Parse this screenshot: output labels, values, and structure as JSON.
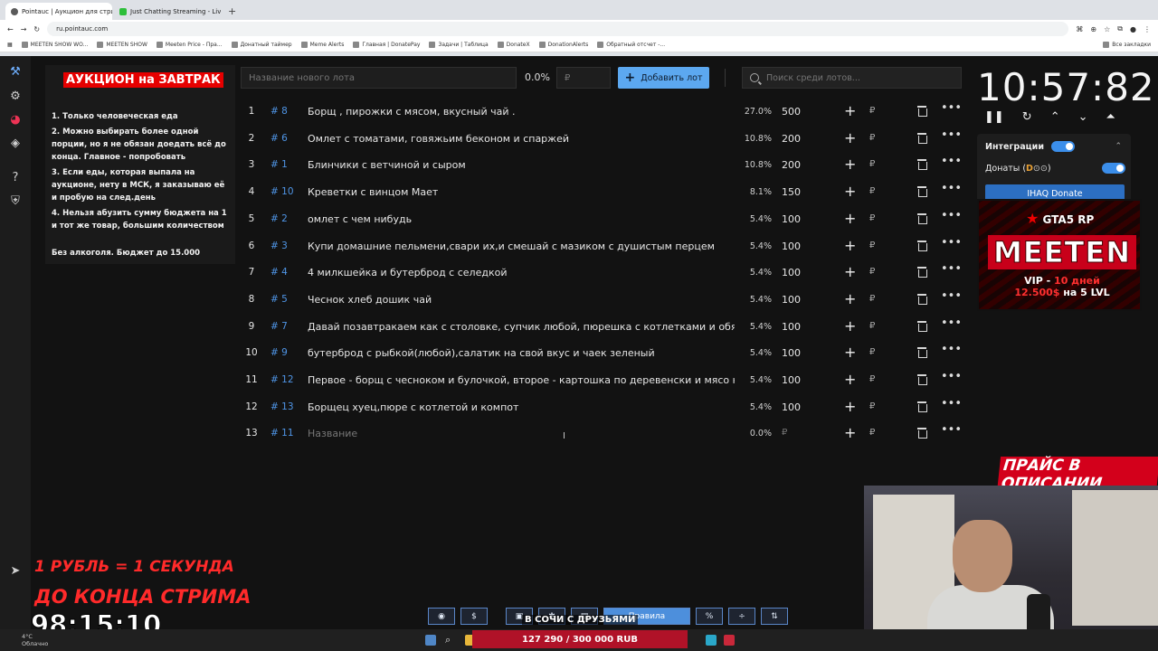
{
  "browser": {
    "tabs": [
      {
        "title": "Pointauc | Аукцион для стримеров",
        "active": true
      },
      {
        "title": "Just Chatting Streaming - Live",
        "active": false
      }
    ],
    "new_tab": "+",
    "address": "ru.pointauc.com",
    "bookmarks": [
      "MEETEN SHOW WO...",
      "MEETEN SHOW",
      "Meeten Price - Пра...",
      "Донатный таймер",
      "Meme Alerts",
      "Главная | DonatePay",
      "Задачи | Таблица",
      "DonateX",
      "DonationAlerts",
      "Обратный отсчет -..."
    ],
    "all_bookmarks": "Все закладки"
  },
  "rules": {
    "title": "АУКЦИОН на ЗАВТРАК",
    "items": [
      "1. Только человеческая еда",
      "2. Можно выбирать более одной порции, но я не обязан доедать всё до конца. Главное - попробовать",
      "3. Если еды, которая выпала на аукционе, нету в МСК, я заказываю её и пробую на след.день",
      "4. Нельзя абузить сумму бюджета на 1 и тот же товар, большим количеством",
      "Без алкоголя. Бюджет до 15.000"
    ]
  },
  "topbar": {
    "lot_placeholder": "Название нового лота",
    "percent": "0.0%",
    "amount_placeholder": "₽",
    "add_button": "Добавить лот",
    "search_placeholder": "Поиск среди лотов..."
  },
  "lots": [
    {
      "num": "1",
      "id": "# 8",
      "name": "Борщ , пирожки с мясом, вкусный чай .",
      "pct": "27.0%",
      "amount": "500"
    },
    {
      "num": "2",
      "id": "# 6",
      "name": "Омлет с томатами, говяжьим беконом и спаржей",
      "pct": "10.8%",
      "amount": "200"
    },
    {
      "num": "3",
      "id": "# 1",
      "name": "Блинчики с ветчиной и сыром",
      "pct": "10.8%",
      "amount": "200"
    },
    {
      "num": "4",
      "id": "# 10",
      "name": "Креветки с винцом Maет",
      "pct": "8.1%",
      "amount": "150"
    },
    {
      "num": "5",
      "id": "# 2",
      "name": "омлет с чем нибудь",
      "pct": "5.4%",
      "amount": "100"
    },
    {
      "num": "6",
      "id": "# 3",
      "name": "Купи домашние пельмени,свари их,и смешай с мазиком с душистым перцем",
      "pct": "5.4%",
      "amount": "100"
    },
    {
      "num": "7",
      "id": "# 4",
      "name": "4 милкшейка и бутерброд с селедкой",
      "pct": "5.4%",
      "amount": "100"
    },
    {
      "num": "8",
      "id": "# 5",
      "name": "Чеснок хлеб дошик чай",
      "pct": "5.4%",
      "amount": "100"
    },
    {
      "num": "9",
      "id": "# 7",
      "name": "Давай позавтракаем как с столовке, супчик любой, пюрешка с котлетками и обязател",
      "pct": "5.4%",
      "amount": "100"
    },
    {
      "num": "10",
      "id": "# 9",
      "name": "бутерброд с рыбкой(любой),салатик на свой вкус и чаек зеленый",
      "pct": "5.4%",
      "amount": "100"
    },
    {
      "num": "11",
      "id": "# 12",
      "name": " Первое - борщ с чесноком и булочкой, второе - картошка по деревенски и мясо на св",
      "pct": "5.4%",
      "amount": "100"
    },
    {
      "num": "12",
      "id": "# 13",
      "name": "Борщец хуец,пюре с котлетой и компот",
      "pct": "5.4%",
      "amount": "100"
    },
    {
      "num": "13",
      "id": "# 11",
      "name": "Название",
      "pct": "0.0%",
      "amount": "₽",
      "placeholder": true
    }
  ],
  "row_currency": "₽",
  "timer": {
    "value": "10:57:82"
  },
  "integrations": {
    "label": "Интеграции",
    "donations_label": "Донаты (",
    "donations_suffix": ")",
    "donate_button": "IHAQ Donate"
  },
  "promo": {
    "game": "GTA5 RP",
    "name": "MEETEN",
    "vip": "VIP - ",
    "days": "10 дней",
    "price": "12.500$",
    "level": " на 5 LVL"
  },
  "price_in_desc": "ПРАЙС В ОПИСАНИИ",
  "stream_counter": {
    "line1": "1 РУБЛЬ = 1 СЕКУНДА",
    "line2": "ДО КОНЦА СТРИМА",
    "time": "98:15:10"
  },
  "bottom_toolbar": {
    "rules_button": "Правила",
    "percent_button": "%",
    "dollar_button": "$"
  },
  "overlay_text": "В СОЧИ С ДРУЗЬЯМИ",
  "goal": "127 290 / 300 000 RUB",
  "weather": {
    "temp": "4°C",
    "desc": "Облачно"
  }
}
